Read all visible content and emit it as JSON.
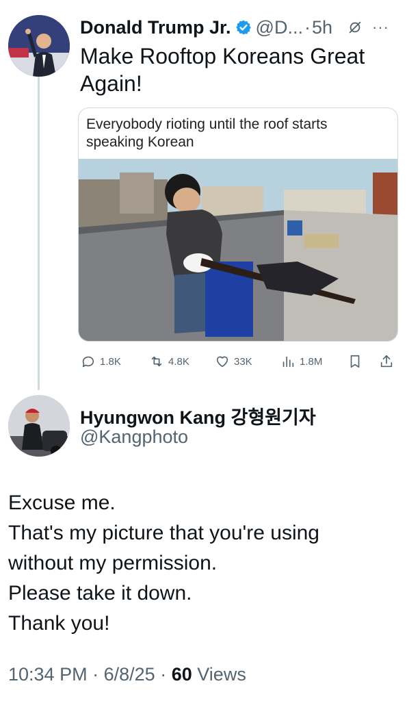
{
  "tweet": {
    "author_name": "Donald Trump Jr.",
    "handle": "@D...",
    "dot": "·",
    "time": "5h",
    "more": "···",
    "text": "Make Rooftop Koreans Great Again!",
    "media": {
      "caption": "Everyobody rioting until the roof starts speaking Korean",
      "image_alt": "rooftop photo of a man holding a rifle"
    },
    "stats": {
      "replies": "1.8K",
      "reposts": "4.8K",
      "likes": "33K",
      "views": "1.8M"
    },
    "icons": [
      "avatar",
      "verified-icon",
      "grok-icon",
      "more-icon",
      "reply-icon",
      "repost-icon",
      "like-icon",
      "views-icon",
      "bookmark-icon",
      "share-icon"
    ]
  },
  "reply": {
    "author_name": "Hyungwon Kang 강형원기자",
    "handle": "@Kangphoto",
    "lines": [
      "Excuse me.",
      "That's my picture that you're using",
      "without my permission.",
      "Please take it down.",
      "Thank you!"
    ],
    "time": "10:34 PM",
    "sep": "·",
    "date": "6/8/25",
    "views_count": "60",
    "views_label": "Views"
  },
  "colors": {
    "text": "#0f1419",
    "secondary": "#536471",
    "verified": "#1d9bf0",
    "border": "#cfd9de"
  }
}
